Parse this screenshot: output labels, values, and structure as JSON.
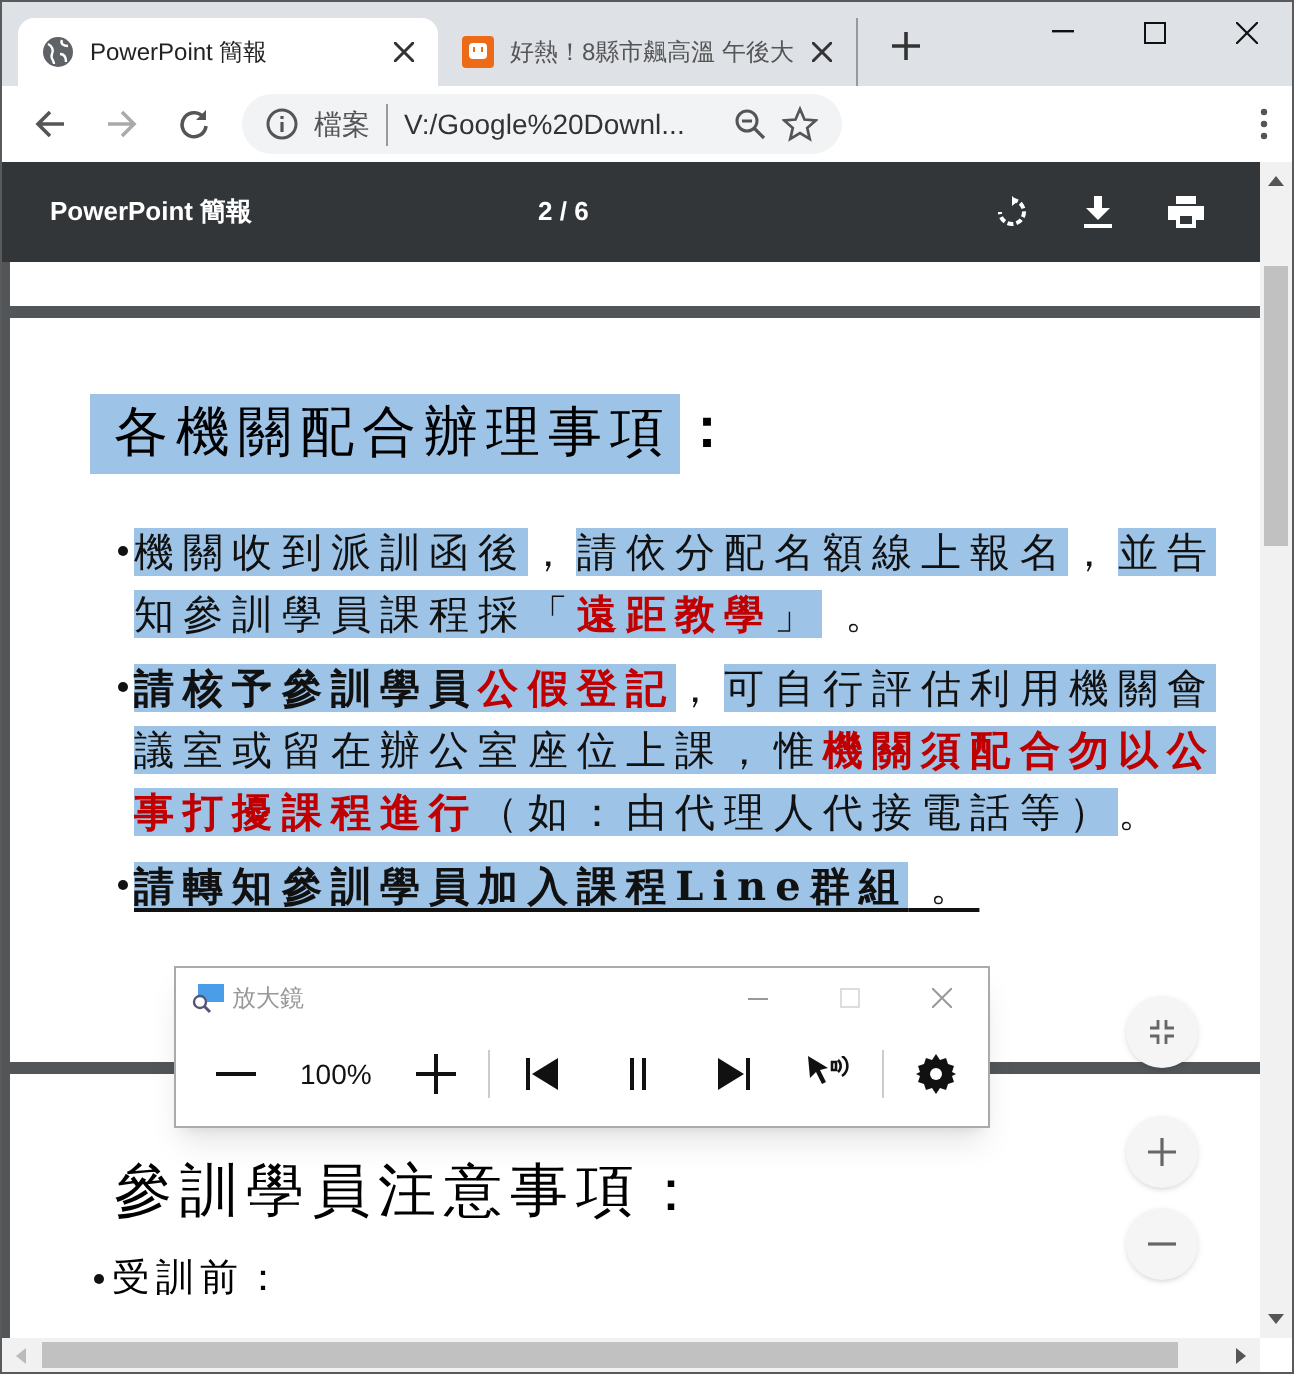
{
  "tabs": [
    {
      "title": "PowerPoint 簡報",
      "selected": true
    },
    {
      "title": "好熱！8縣市飆高溫 午後大",
      "selected": false
    }
  ],
  "address": {
    "security_label": "檔案",
    "url": "V:/Google%20Downl..."
  },
  "viewer": {
    "title": "PowerPoint 簡報",
    "page": "2 / 6"
  },
  "page_1": {
    "heading": "各機關配合辦理事項",
    "heading_suffix": "：",
    "bullets": [
      [
        {
          "text": "機關收到派訓函後",
          "kind": "highlight"
        },
        {
          "text": "，",
          "kind": "plain"
        },
        {
          "text": "請依分配名額線上報名",
          "kind": "highlight"
        },
        {
          "text": "，",
          "kind": "plain"
        },
        {
          "text": "並告知參訓學員課程採「",
          "kind": "highlight"
        },
        {
          "text": "遠距教學",
          "kind": "alert"
        },
        {
          "text": "」",
          "kind": "highlight"
        },
        {
          "text": " 。",
          "kind": "plain"
        }
      ],
      [
        {
          "text": "請核予參訓學員",
          "kind": "strong"
        },
        {
          "text": "公假登記",
          "kind": "alert"
        },
        {
          "text": "，",
          "kind": "plain"
        },
        {
          "text": "可自行評估利用機關會議室或留在辦公室座位上課，惟",
          "kind": "highlight"
        },
        {
          "text": "機關須配合勿以公事打擾課程進行",
          "kind": "alert"
        },
        {
          "text": "（如：由代理人代接電話等）",
          "kind": "highlight"
        },
        {
          "text": "。",
          "kind": "plain"
        }
      ],
      [
        {
          "text": "請轉知參訓學員加入課程Line群組",
          "kind": "underlined"
        },
        {
          "text": " 。",
          "kind": "trailing"
        }
      ]
    ]
  },
  "page_2": {
    "heading": "參訓學員注意事項：",
    "bullets": [
      "受訓前："
    ]
  },
  "magnifier": {
    "title": "放大鏡",
    "zoom": "100%"
  }
}
